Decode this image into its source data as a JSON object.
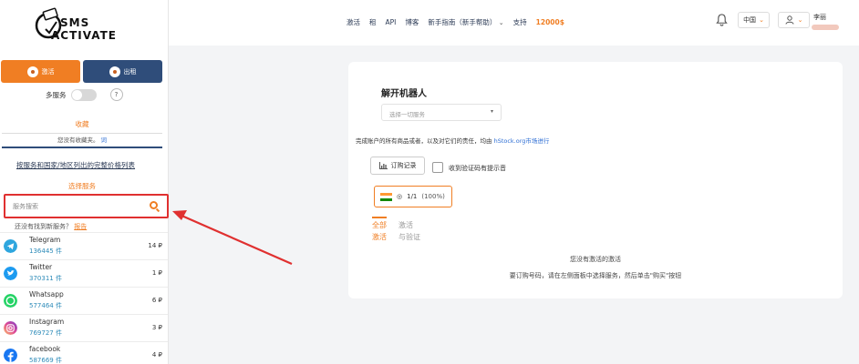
{
  "logo": {
    "line1": "SMS",
    "line2": "ACTIVATE"
  },
  "sidebar": {
    "mode_activate": "激活",
    "mode_rent": "出租",
    "multi_service": "多服务",
    "help": "?",
    "favorites_title": "收藏",
    "favorites_empty": "您没有收藏夹。",
    "favorites_link": "词",
    "price_list_link": "按服务和国家/地区列出的完整价格列表",
    "select_service_title": "选择服务",
    "search_placeholder": "服务搜索",
    "not_found_text": "还没有找到新服务？",
    "not_found_link": "报告",
    "services": [
      {
        "name": "Telegram",
        "count": "136445 件",
        "price": "14 ₽",
        "color": "#2ea6de"
      },
      {
        "name": "Twitter",
        "count": "370311 件",
        "price": "1 ₽",
        "color": "#1d9bf0"
      },
      {
        "name": "Whatsapp",
        "count": "577464 件",
        "price": "6 ₽",
        "color": "#25d366"
      },
      {
        "name": "Instagram",
        "count": "769727 件",
        "price": "3 ₽",
        "color": "#d6249f"
      },
      {
        "name": "facebook",
        "count": "587669 件",
        "price": "4 ₽",
        "color": "#1877f2"
      }
    ]
  },
  "topnav": {
    "items": [
      "激活",
      "租",
      "API",
      "博客",
      "新手指南（新手帮助）",
      "支持"
    ],
    "balance": "12000$",
    "lang": "中国",
    "user_name": "李丽"
  },
  "main": {
    "title": "解开机器人",
    "dropdown_placeholder": "选择一切服务",
    "note_text": "完成账户的所有商品或者，以及对它们的责任，均由 ",
    "note_link": "hStock.org市场进行",
    "history_button": "订购记录",
    "checkbox_label": "收到验证码有提示音",
    "flag_count": "1/1",
    "flag_percent": "(100%)",
    "tab_all_1": "全部",
    "tab_all_2": "激活",
    "tab_other_1": "激活",
    "tab_other_2": "与验证",
    "empty_1": "您没有激活的激活",
    "empty_2": "要订购号码，请在左侧面板中选择服务，然后单击\"购买\"按钮"
  }
}
